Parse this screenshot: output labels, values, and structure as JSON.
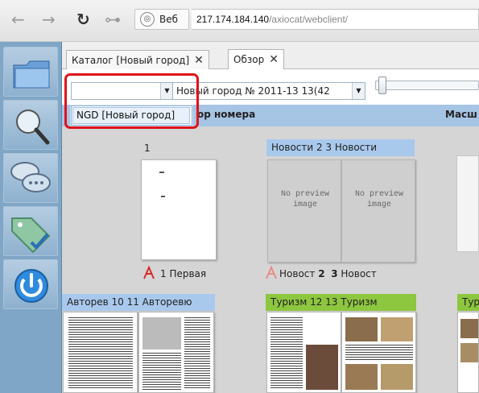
{
  "browser": {
    "back": "←",
    "forward": "→",
    "reload": "↻",
    "key": "⊶",
    "web_label": "Веб",
    "url_host": "217.174.184.140",
    "url_path": "/axiocat/webclient/"
  },
  "rail": {
    "items": [
      "folder-icon",
      "search-icon",
      "chat-icon",
      "tag-check-icon",
      "power-icon"
    ]
  },
  "tabs": [
    {
      "label": "Каталог [Новый город]",
      "close": "✕"
    },
    {
      "label": "Обзор",
      "close": "✕"
    }
  ],
  "toolbar": {
    "city_select_value": "",
    "issue_select_value": "Новый город № 2011-13 13(42",
    "dd_glyph": "▼"
  },
  "popup": {
    "item": "NGD [Новый город]"
  },
  "header_band": {
    "col1": "ор номера",
    "col2": "Масш"
  },
  "grid": {
    "page1_number": "1",
    "pages_news_header": "Новости   2  3  Новости",
    "no_preview": "No preview image",
    "row1_caption_left": "1  Первая",
    "row1_caption_mid_a": "Новост",
    "row1_caption_mid_num1": "2",
    "row1_caption_mid_num2": "3",
    "row1_caption_mid_b": "Новост",
    "row2_left_header": "Авторев   10   11  Авторевю",
    "row2_mid_header": "Туризм    12   13   Туризм",
    "row2_right_header": "Тур"
  },
  "colors": {
    "accent_red": "#e0141a",
    "header_blue": "#a6c4e4",
    "news_blue": "#a9c9ec",
    "tourism_green": "#8dc63f"
  }
}
